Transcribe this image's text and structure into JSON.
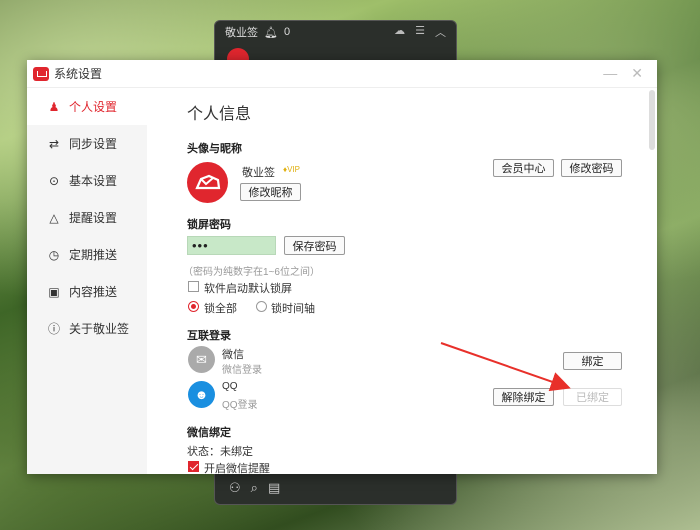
{
  "bg_widget": {
    "title": "敬业签",
    "count": "0"
  },
  "window": {
    "title": "系统设置"
  },
  "sidebar": {
    "items": [
      {
        "label": "个人设置",
        "icon": "user-icon",
        "active": true
      },
      {
        "label": "同步设置",
        "icon": "sync-icon"
      },
      {
        "label": "基本设置",
        "icon": "settings-icon"
      },
      {
        "label": "提醒设置",
        "icon": "bell-icon"
      },
      {
        "label": "定期推送",
        "icon": "clock-icon"
      },
      {
        "label": "内容推送",
        "icon": "document-icon"
      },
      {
        "label": "关于敬业签",
        "icon": "info-icon"
      }
    ]
  },
  "content": {
    "title": "个人信息",
    "avatar_section": {
      "heading": "头像与昵称",
      "nickname": "敬业签",
      "vip": "VIP",
      "edit_nickname": "修改昵称",
      "member_center": "会员中心",
      "change_password": "修改密码"
    },
    "lock_section": {
      "heading": "锁屏密码",
      "password_value": "•••",
      "save_password": "保存密码",
      "hint": "（密码为纯数字在1~6位之间）",
      "auto_lock_label": "软件启动默认锁屏",
      "lock_all": "锁全部",
      "lock_timeline": "锁时间轴"
    },
    "login_section": {
      "heading": "互联登录",
      "wechat": {
        "name": "微信",
        "sub": "微信登录",
        "bind": "绑定"
      },
      "qq": {
        "name": "QQ",
        "sub": "QQ登录",
        "unbind": "解除绑定",
        "bound": "已绑定"
      }
    },
    "wechat_bind": {
      "heading": "微信绑定",
      "status": "状态：未绑定",
      "enable_remind": "开启微信提醒"
    }
  },
  "colors": {
    "accent": "#e0262e",
    "password_bg": "#c8e8c8"
  }
}
